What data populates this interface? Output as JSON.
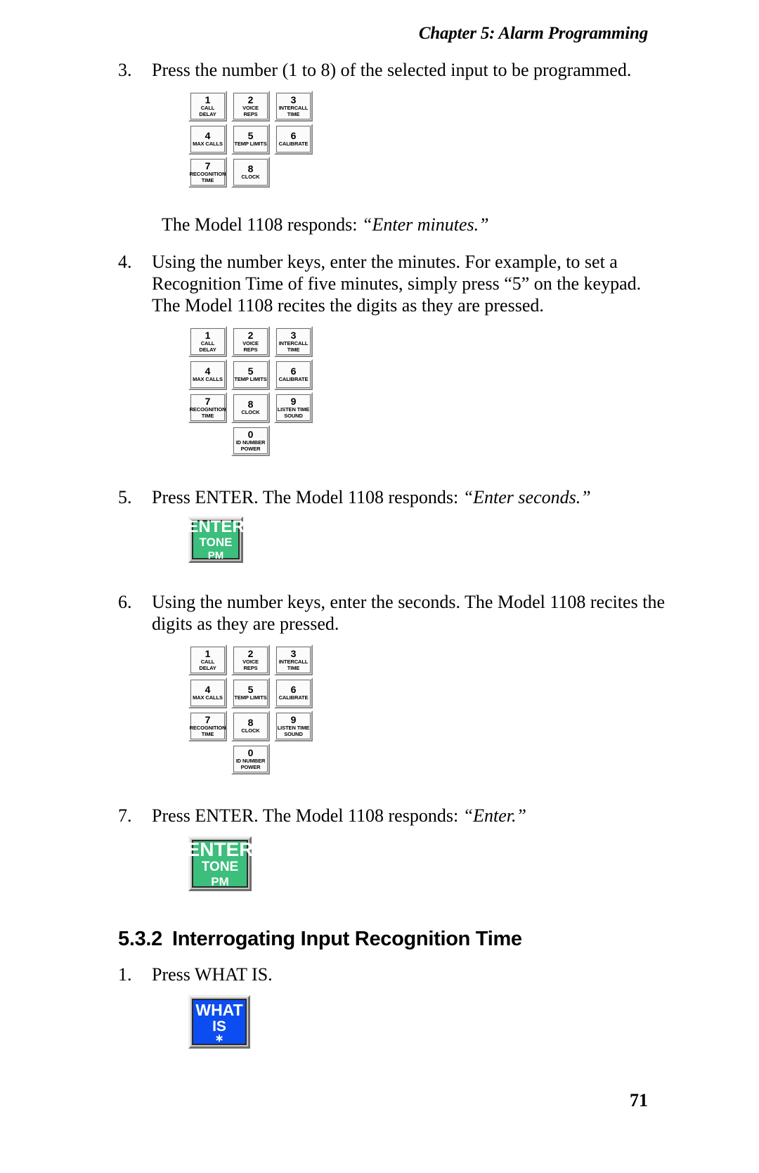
{
  "header": {
    "running_head": "Chapter 5: Alarm Programming"
  },
  "folio": {
    "page_number": "71"
  },
  "steps": [
    {
      "number": "3.",
      "text": "Press the number (1 to 8) of the selected input to be programmed."
    },
    {
      "number": "4.",
      "text": "Using the number keys, enter the minutes. For example, to set a Recognition Time of five minutes, simply press “5” on the keypad. The Model 1108 recites the digits as they are pressed."
    },
    {
      "number": "5.",
      "text_plain": "Press ENTER. The Model 1108 responds: ",
      "text_quote": "“Enter seconds.”"
    },
    {
      "number": "6.",
      "text": "Using the number keys, enter the seconds. The Model 1108 recites the digits as they are pressed."
    },
    {
      "number": "7.",
      "text_plain": "Press ENTER. The Model 1108 responds: ",
      "text_quote": "“Enter.”"
    }
  ],
  "response_line": {
    "plain": "The Model 1108 responds: ",
    "quote": "“Enter minutes.”"
  },
  "keypad_keys": {
    "k1": {
      "digit": "1",
      "line1": "CALL",
      "line2": "DELAY"
    },
    "k2": {
      "digit": "2",
      "line1": "VOICE",
      "line2": "REPS"
    },
    "k3": {
      "digit": "3",
      "line1": "INTERCALL",
      "line2": "TIME"
    },
    "k4": {
      "digit": "4",
      "line1": "MAX CALLS",
      "line2": ""
    },
    "k5": {
      "digit": "5",
      "line1": "TEMP LIMITS",
      "line2": ""
    },
    "k6": {
      "digit": "6",
      "line1": "CALIBRATE",
      "line2": ""
    },
    "k7": {
      "digit": "7",
      "line1": "RECOGNITION",
      "line2": "TIME"
    },
    "k8": {
      "digit": "8",
      "line1": "CLOCK",
      "line2": ""
    },
    "k9": {
      "digit": "9",
      "line1": "LISTEN TIME",
      "line2": "SOUND"
    },
    "k0": {
      "digit": "0",
      "line1": "ID NUMBER",
      "line2": "POWER"
    }
  },
  "function_keys": {
    "enter": {
      "line1": "ENTER",
      "line2": "TONE",
      "line3": "PM",
      "color": "#3cbe7c"
    },
    "what_is": {
      "line1": "WHAT",
      "line2": "IS",
      "line3": "∗",
      "color": "#0b4df0"
    }
  },
  "section": {
    "number": "5.3.2",
    "title": "Interrogating Input Recognition Time",
    "steps": [
      {
        "number": "1.",
        "text": "Press WHAT IS."
      }
    ]
  }
}
